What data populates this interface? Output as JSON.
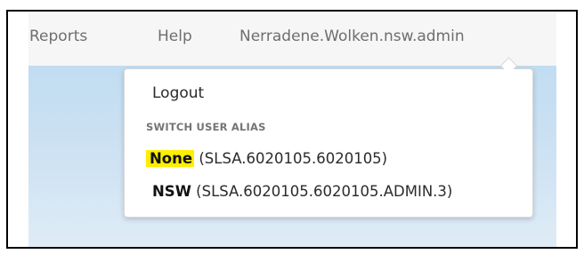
{
  "navbar": {
    "items": [
      {
        "label": "Reports"
      },
      {
        "label": "Help"
      },
      {
        "label": "Nerradene.Wolken.nsw.admin"
      }
    ]
  },
  "dropdown": {
    "logout_label": "Logout",
    "section_header": "SWITCH USER ALIAS",
    "aliases": [
      {
        "name": "None",
        "code": "(SLSA.6020105.6020105)",
        "highlighted": true
      },
      {
        "name": "NSW",
        "code": "(SLSA.6020105.6020105.ADMIN.3)",
        "highlighted": false
      }
    ]
  },
  "colors": {
    "highlight": "#ffee00",
    "navbar_bg": "#f6f6f6",
    "content_bg": "#c8dff2",
    "nav_text": "#6e6e6e"
  },
  "icons": {
    "dropdown_caret": "caret-up-icon"
  }
}
